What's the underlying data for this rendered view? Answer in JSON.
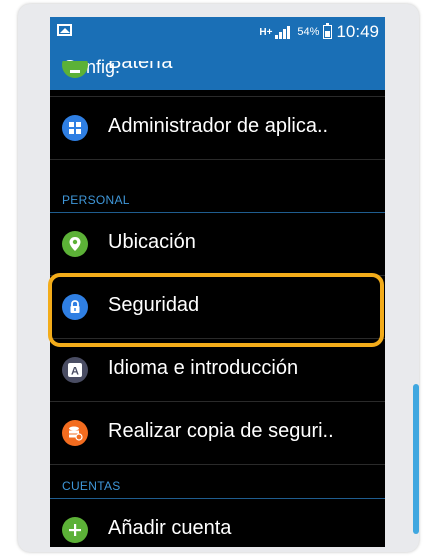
{
  "status_bar": {
    "network_type": "H+",
    "battery_percent": "54%",
    "time": "10:49"
  },
  "action_bar": {
    "title": "Config."
  },
  "settings": {
    "battery_partial": "Batería",
    "app_manager": "Administrador de aplica..",
    "section_personal": "PERSONAL",
    "location": "Ubicación",
    "security": "Seguridad",
    "language": "Idioma e introducción",
    "backup": "Realizar copia de seguri..",
    "section_accounts": "CUENTAS",
    "add_account": "Añadir cuenta"
  },
  "icons": {
    "battery": "battery-icon",
    "app_manager": "grid-icon",
    "location": "location-pin-icon",
    "security": "lock-icon",
    "language": "keyboard-letter-icon",
    "backup": "database-backup-icon",
    "add_account": "plus-icon"
  },
  "colors": {
    "bar_blue": "#1a6fb6",
    "section_blue": "#3f97d9",
    "highlight": "#f3ac1a",
    "icon_green": "#5cb137",
    "icon_blue": "#2f7fe3",
    "icon_gray": "#4a4d63",
    "icon_orange": "#f36c1f"
  }
}
